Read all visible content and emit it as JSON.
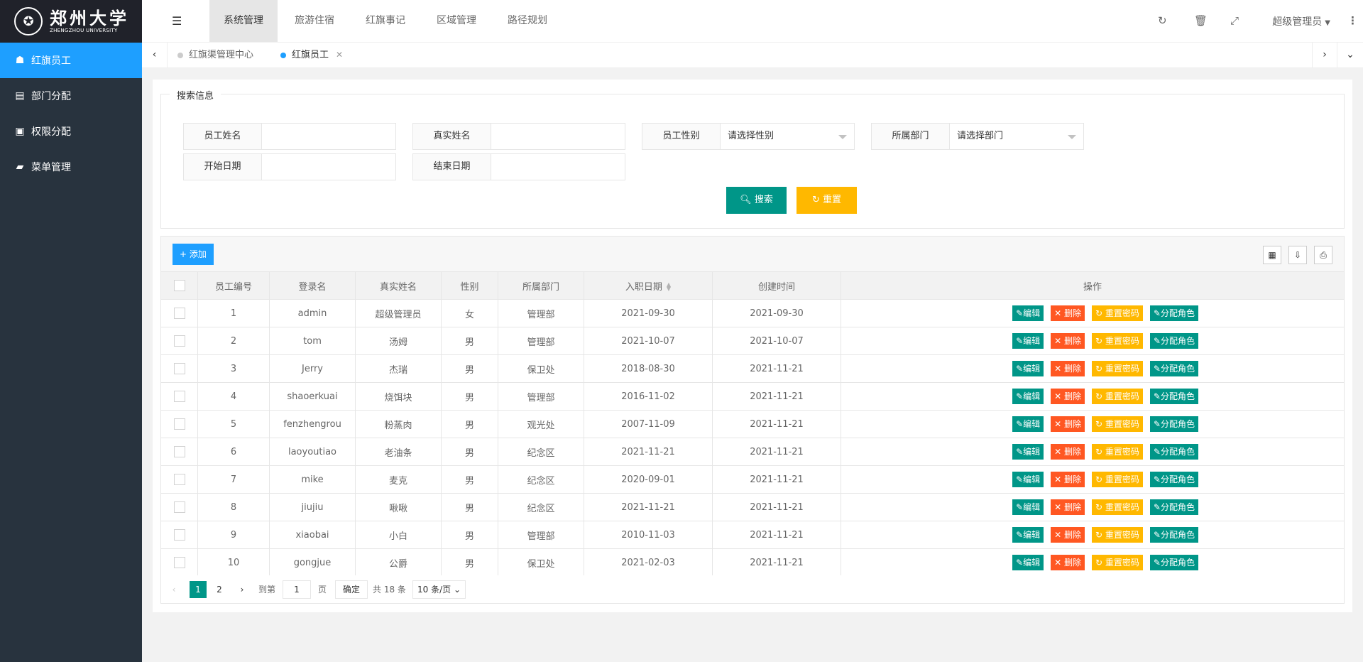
{
  "logo": {
    "cn": "郑州大学",
    "en": "ZHENGZHOU UNIVERSITY"
  },
  "sidebar": {
    "items": [
      {
        "label": "红旗员工"
      },
      {
        "label": "部门分配"
      },
      {
        "label": "权限分配"
      },
      {
        "label": "菜单管理"
      }
    ]
  },
  "header": {
    "tabs": [
      "系统管理",
      "旅游住宿",
      "红旗事记",
      "区域管理",
      "路径规划"
    ],
    "user": "超级管理员"
  },
  "page_tabs": [
    {
      "label": "红旗渠管理中心"
    },
    {
      "label": "红旗员工"
    }
  ],
  "search": {
    "legend": "搜索信息",
    "username_label": "员工姓名",
    "realname_label": "真实姓名",
    "gender_label": "员工性别",
    "gender_placeholder": "请选择性别",
    "dept_label": "所属部门",
    "dept_placeholder": "请选择部门",
    "start_label": "开始日期",
    "end_label": "结束日期",
    "search_btn": "搜索",
    "reset_btn": "重置"
  },
  "toolbar": {
    "add": "添加"
  },
  "table": {
    "headers": [
      "员工编号",
      "登录名",
      "真实姓名",
      "性别",
      "所属部门",
      "入职日期",
      "创建时间",
      "操作"
    ],
    "ops": [
      "编辑",
      "删除",
      "重置密码",
      "分配角色"
    ],
    "rows": [
      {
        "id": "1",
        "login": "admin",
        "name": "超级管理员",
        "gender": "女",
        "dept": "管理部",
        "hire": "2021-09-30",
        "created": "2021-09-30"
      },
      {
        "id": "2",
        "login": "tom",
        "name": "汤姆",
        "gender": "男",
        "dept": "管理部",
        "hire": "2021-10-07",
        "created": "2021-10-07"
      },
      {
        "id": "3",
        "login": "Jerry",
        "name": "杰瑞",
        "gender": "男",
        "dept": "保卫处",
        "hire": "2018-08-30",
        "created": "2021-11-21"
      },
      {
        "id": "4",
        "login": "shaoerkuai",
        "name": "烧饵块",
        "gender": "男",
        "dept": "管理部",
        "hire": "2016-11-02",
        "created": "2021-11-21"
      },
      {
        "id": "5",
        "login": "fenzhengrou",
        "name": "粉蒸肉",
        "gender": "男",
        "dept": "观光处",
        "hire": "2007-11-09",
        "created": "2021-11-21"
      },
      {
        "id": "6",
        "login": "laoyoutiao",
        "name": "老油条",
        "gender": "男",
        "dept": "纪念区",
        "hire": "2021-11-21",
        "created": "2021-11-21"
      },
      {
        "id": "7",
        "login": "mike",
        "name": "麦克",
        "gender": "男",
        "dept": "纪念区",
        "hire": "2020-09-01",
        "created": "2021-11-21"
      },
      {
        "id": "8",
        "login": "jiujiu",
        "name": "啾啾",
        "gender": "男",
        "dept": "纪念区",
        "hire": "2021-11-21",
        "created": "2021-11-21"
      },
      {
        "id": "9",
        "login": "xiaobai",
        "name": "小白",
        "gender": "男",
        "dept": "管理部",
        "hire": "2010-11-03",
        "created": "2021-11-21"
      },
      {
        "id": "10",
        "login": "gongjue",
        "name": "公爵",
        "gender": "男",
        "dept": "保卫处",
        "hire": "2021-02-03",
        "created": "2021-11-21"
      }
    ]
  },
  "pager": {
    "pages": [
      "1",
      "2"
    ],
    "goto": "到第",
    "page_value": "1",
    "page_unit": "页",
    "ok": "确定",
    "total": "共 18 条",
    "per_page": "10 条/页"
  },
  "colors": {
    "sidebar": "#28333e",
    "active": "#1e9fff",
    "green": "#009688",
    "red": "#ff5722",
    "yellow": "#ffb800"
  }
}
